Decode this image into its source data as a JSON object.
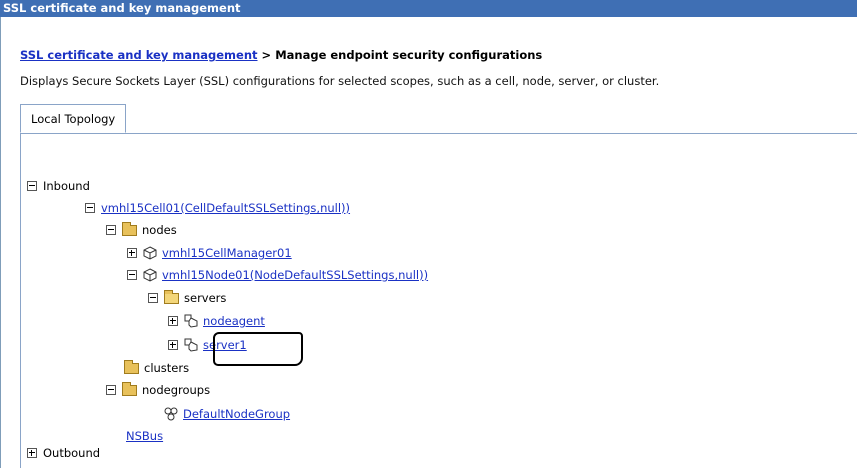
{
  "window": {
    "title": "SSL certificate and key management"
  },
  "breadcrumb": {
    "parent_link": "SSL certificate and key management",
    "separator": " > ",
    "current": "Manage endpoint security configurations"
  },
  "description": "Displays Secure Sockets Layer (SSL) configurations for selected scopes, such as a cell, node, server, or cluster.",
  "tabs": [
    {
      "label": "Local Topology"
    }
  ],
  "tree": {
    "inbound": "Inbound",
    "cell": "vmhl15Cell01(CellDefaultSSLSettings,null))",
    "nodes": "nodes",
    "cell_manager": "vmhl15CellManager01",
    "node": "vmhl15Node01(NodeDefaultSSLSettings,null))",
    "servers": "servers",
    "nodeagent": "nodeagent",
    "server1": "server1",
    "clusters": "clusters",
    "nodegroups": "nodegroups",
    "default_node_group": "DefaultNodeGroup",
    "nsbus": "NSBus",
    "outbound": "Outbound"
  },
  "colors": {
    "titlebar": "#3f6fb4",
    "link": "#1a31c4"
  }
}
